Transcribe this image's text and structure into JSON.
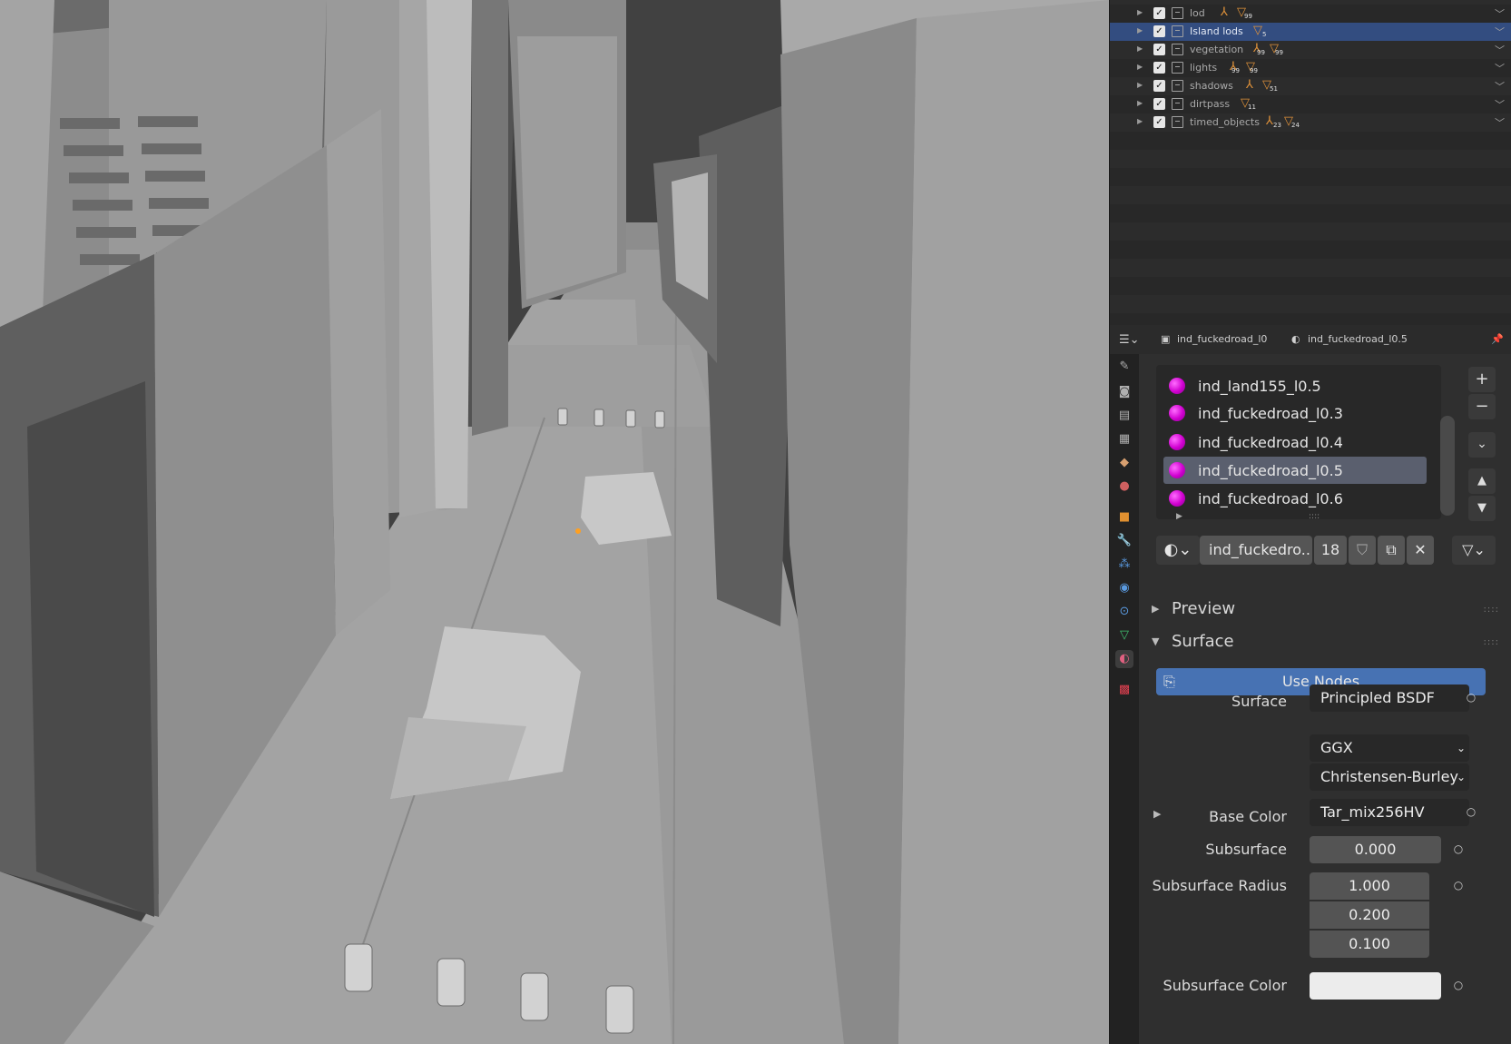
{
  "outliner": {
    "rows": [
      {
        "name": "lod",
        "counts": [
          "99"
        ],
        "selected": false
      },
      {
        "name": "Island lods",
        "counts": [
          "5"
        ],
        "selected": true
      },
      {
        "name": "vegetation",
        "counts": [
          "99",
          "99"
        ],
        "selected": false
      },
      {
        "name": "lights",
        "counts": [
          "99",
          "99"
        ],
        "selected": false
      },
      {
        "name": "shadows",
        "counts": [
          "51"
        ],
        "selected": false
      },
      {
        "name": "dirtpass",
        "counts": [
          "11"
        ],
        "selected": false
      },
      {
        "name": "timed_objects",
        "counts": [
          "23",
          "24"
        ],
        "selected": false
      }
    ]
  },
  "properties": {
    "breadcrumb_object": "ind_fuckedroad_l0",
    "breadcrumb_material": "ind_fuckedroad_l0.5",
    "material_slots": [
      {
        "name": "ind_land155_l0.5",
        "selected": false
      },
      {
        "name": "ind_fuckedroad_l0.3",
        "selected": false
      },
      {
        "name": "ind_fuckedroad_l0.4",
        "selected": false
      },
      {
        "name": "ind_fuckedroad_l0.5",
        "selected": true
      },
      {
        "name": "ind_fuckedroad_l0.6",
        "selected": false
      }
    ],
    "material_name": "ind_fuckedro..",
    "user_count": "18",
    "sections": {
      "preview": "Preview",
      "surface": "Surface"
    },
    "use_nodes_label": "Use Nodes",
    "surface_label": "Surface",
    "surface_value": "Principled BSDF",
    "distribution": "GGX",
    "subsurface_method": "Christensen-Burley",
    "base_color_label": "Base Color",
    "base_color_value": "Tar_mix256HV",
    "subsurface_label": "Subsurface",
    "subsurface_value": "0.000",
    "subsurface_radius_label": "Subsurface Radius",
    "subsurface_radius": [
      "1.000",
      "0.200",
      "0.100"
    ],
    "subsurface_color_label": "Subsurface Color"
  },
  "colors": {
    "selection": "#334d80",
    "use_nodes": "#4772b3",
    "material_ball": "#d000d0"
  }
}
